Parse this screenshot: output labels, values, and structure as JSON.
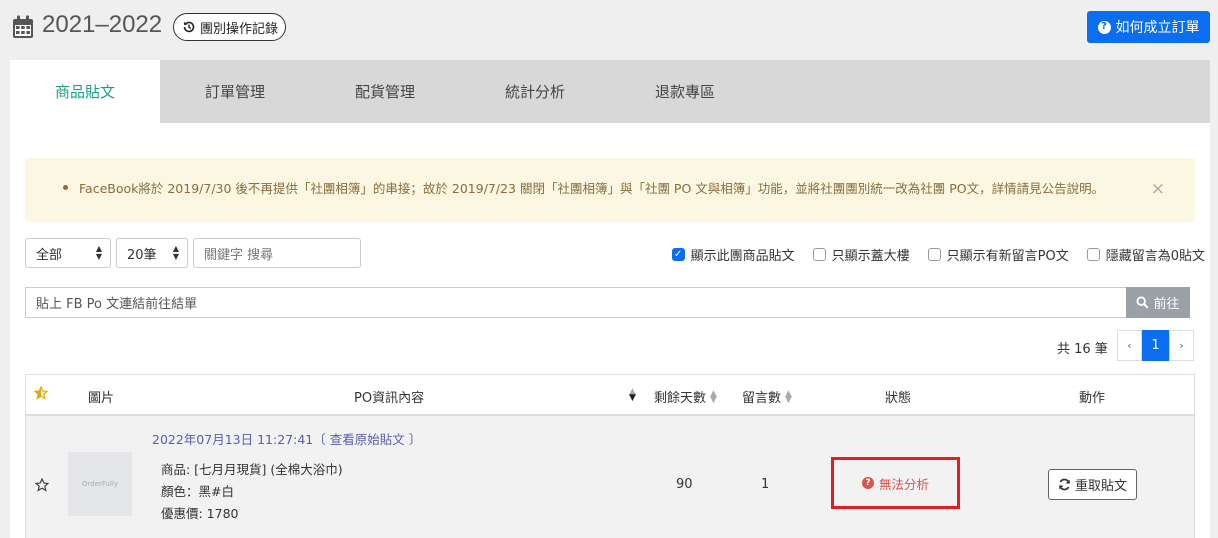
{
  "header": {
    "title": "2021–2022",
    "history_label": "團別操作記錄",
    "howto_label": "如何成立訂單"
  },
  "tabs": [
    {
      "label": "商品貼文",
      "active": true
    },
    {
      "label": "訂單管理",
      "active": false
    },
    {
      "label": "配貨管理",
      "active": false
    },
    {
      "label": "統計分析",
      "active": false
    },
    {
      "label": "退款專區",
      "active": false
    }
  ],
  "notice": {
    "text": "FaceBook將於 2019/7/30 後不再提供「社團相簿」的串接；故於 2019/7/23 關閉「社團相簿」與「社團 PO 文與相簿」功能，並將社團團別統一改為社團 PO文，詳情請見公告說明。",
    "close": "×"
  },
  "filters": {
    "scope_selected": "全部",
    "page_size_selected": "20筆",
    "search_placeholder": "關鍵字 搜尋",
    "checkbox_show_group": "顯示此團商品貼文",
    "checkbox_show_group_checked": true,
    "checkbox_big_floor": "只顯示蓋大樓",
    "checkbox_new_comment": "只顯示有新留言PO文",
    "checkbox_hide_zero": "隱藏留言為0貼文"
  },
  "urlbar": {
    "placeholder": "貼上 FB Po 文連結前往結單",
    "go_label": "前往"
  },
  "pagination": {
    "total_text": "共 16 筆",
    "prev": "‹",
    "current": "1",
    "next": "›"
  },
  "table": {
    "headers": {
      "image": "圖片",
      "content": "PO資訊內容",
      "days_left": "剩餘天數",
      "comments": "留言數",
      "status": "狀態",
      "action": "動作"
    },
    "rows": [
      {
        "date": "2022年07月13日 11:27:41",
        "view_original": "〔 查看原始貼文 〕",
        "thumb_text": "OrderFully",
        "product": "商品: [七月月現貨] (全棉大浴巾)",
        "color": "顏色：黑#白",
        "price": "優惠價: 1780",
        "days_left": "90",
        "comments": "1",
        "status": "無法分析",
        "action_label": "重取貼文"
      }
    ]
  },
  "colors": {
    "accent": "#0b6ef0",
    "tab_active": "#1a9f8a",
    "status_error": "#d9534f",
    "highlight_box": "#e02020"
  }
}
